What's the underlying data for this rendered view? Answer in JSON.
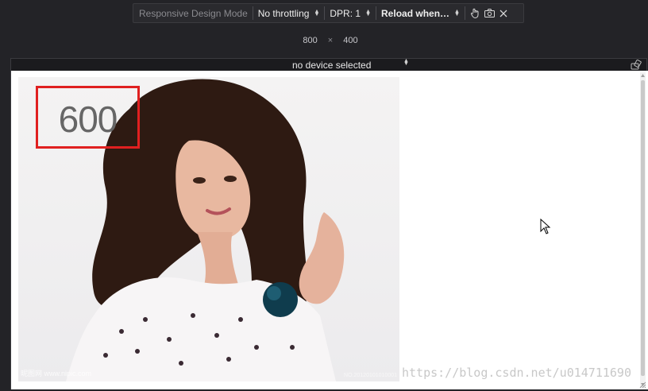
{
  "toolbar": {
    "title": "Responsive Design Mode",
    "throttling": "No throttling",
    "dpr": "DPR: 1",
    "reload": "Reload when…",
    "icons": [
      "touch-icon",
      "camera-icon",
      "close-icon"
    ]
  },
  "viewport_size": {
    "width": "800",
    "separator": "×",
    "height": "400"
  },
  "device_bar": {
    "device": "no device selected",
    "icons": [
      "rotate-icon"
    ]
  },
  "page": {
    "highlight_label": "600",
    "highlight_color": "#e02020",
    "photo_watermark_left": "昵图网 www.nipic.com",
    "photo_watermark_right": "NO.20120101010001",
    "blog_watermark": "https://blog.csdn.net/u014711690"
  },
  "colors": {
    "chrome_bg": "#232327",
    "toolbar_bg": "#2a2a2e",
    "viewport_bg": "#ffffff"
  }
}
